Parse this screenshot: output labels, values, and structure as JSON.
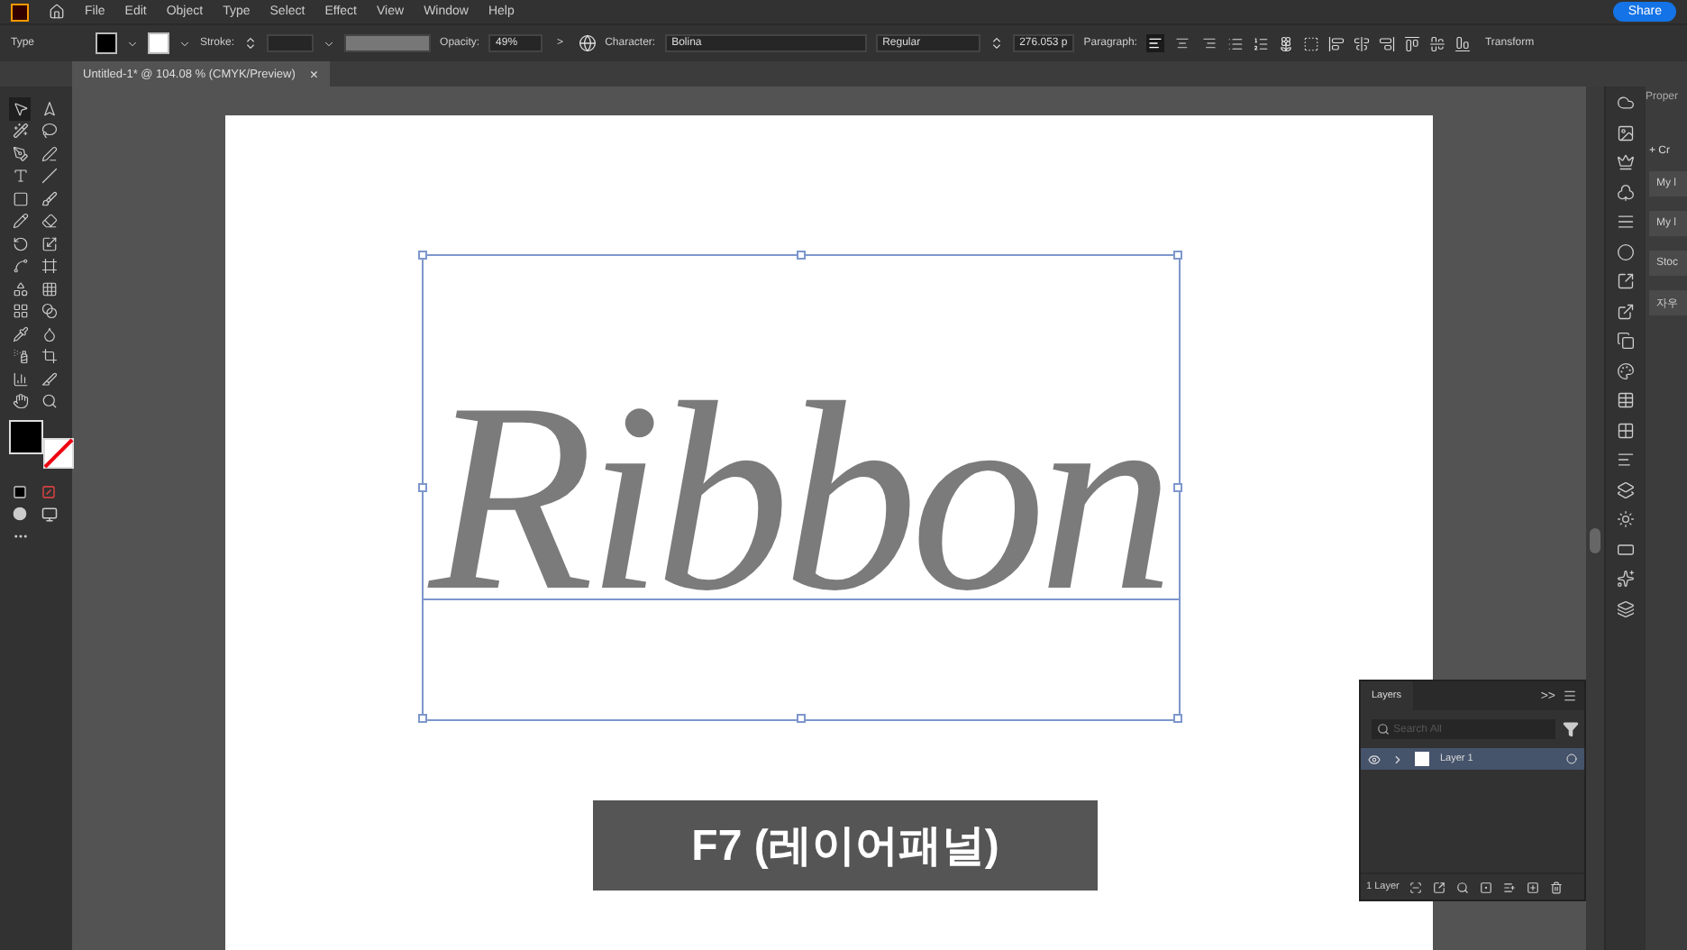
{
  "app_menu": [
    "File",
    "Edit",
    "Object",
    "Type",
    "Select",
    "Effect",
    "View",
    "Window",
    "Help"
  ],
  "share_button": "Share",
  "control_bar": {
    "mode": "Type",
    "stroke_label": "Stroke:",
    "opacity_label": "Opacity:",
    "opacity_value": "49%",
    "more": ">",
    "character_label": "Character:",
    "font": "Bolina",
    "style": "Regular",
    "size": "276.053 p",
    "paragraph_label": "Paragraph:",
    "align": [
      {
        "selected": true
      },
      {
        "selected": false
      },
      {
        "selected": false
      }
    ],
    "transform_button": "Transform"
  },
  "document_tab": {
    "title": "Untitled-1* @ 104.08 % (CMYK/Preview)",
    "close": "×",
    "selected": true
  },
  "artboard": {
    "text": "Ribbon",
    "caption": "F7 (레이어패널)"
  },
  "properties_panel": {
    "title": "Proper",
    "create_button": "+ Cr",
    "items": [
      "My l",
      "My l",
      "Stoc",
      "자우"
    ]
  },
  "layers_panel": {
    "title": "Layers",
    "collapse": ">>",
    "search_placeholder": "Search All",
    "layers": [
      {
        "name": "Layer 1",
        "visible": true,
        "selected": true
      }
    ],
    "footer": "1 Layer"
  }
}
